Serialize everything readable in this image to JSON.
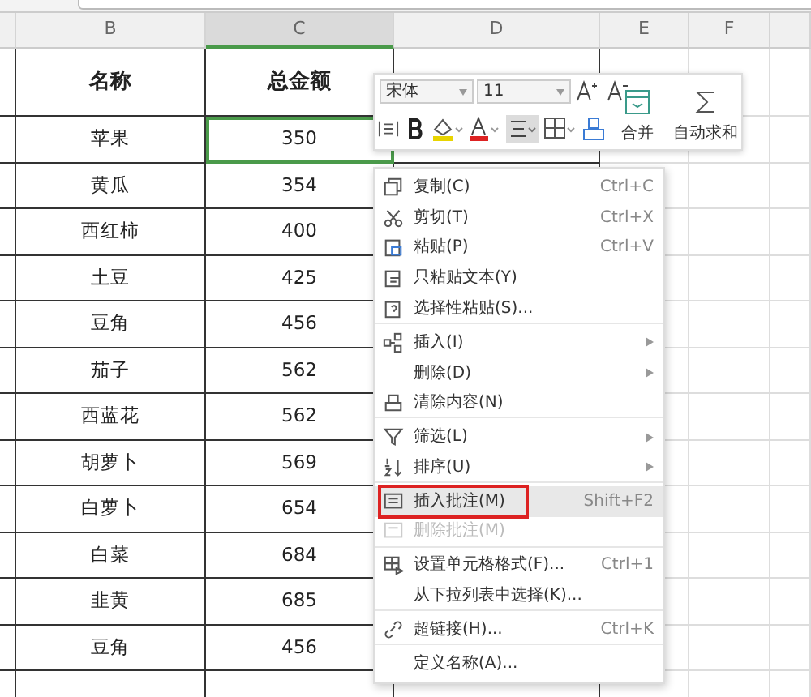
{
  "columns": [
    {
      "label": "B",
      "selected": false
    },
    {
      "label": "C",
      "selected": true
    },
    {
      "label": "D",
      "selected": false
    },
    {
      "label": "E",
      "selected": false
    },
    {
      "label": "F",
      "selected": false
    }
  ],
  "header": {
    "name": "名称",
    "amount": "总金额"
  },
  "rows": [
    {
      "name": "苹果",
      "amount": "350",
      "selected": true
    },
    {
      "name": "黄瓜",
      "amount": "354",
      "selected": false
    },
    {
      "name": "西红柿",
      "amount": "400",
      "selected": false
    },
    {
      "name": "土豆",
      "amount": "425",
      "selected": false
    },
    {
      "name": "豆角",
      "amount": "456",
      "selected": false
    },
    {
      "name": "茄子",
      "amount": "562",
      "selected": false
    },
    {
      "name": "西蓝花",
      "amount": "562",
      "selected": false
    },
    {
      "name": "胡萝卜",
      "amount": "569",
      "selected": false
    },
    {
      "name": "白萝卜",
      "amount": "654",
      "selected": false
    },
    {
      "name": "白菜",
      "amount": "684",
      "selected": false
    },
    {
      "name": "韭黄",
      "amount": "685",
      "selected": false
    },
    {
      "name": "豆角",
      "amount": "456",
      "selected": false
    }
  ],
  "mini_toolbar": {
    "font": "宋体",
    "size": "11",
    "merge": "合并",
    "autosum": "自动求和"
  },
  "context_menu": [
    {
      "label": "复制(C)",
      "shortcut": "Ctrl+C",
      "selected": false,
      "disabled": false,
      "submenu": false,
      "group_end": false
    },
    {
      "label": "剪切(T)",
      "shortcut": "Ctrl+X",
      "selected": false,
      "disabled": false,
      "submenu": false,
      "group_end": false
    },
    {
      "label": "粘贴(P)",
      "shortcut": "Ctrl+V",
      "selected": false,
      "disabled": false,
      "submenu": false,
      "group_end": false
    },
    {
      "label": "只粘贴文本(Y)",
      "selected": false,
      "disabled": false,
      "submenu": false,
      "group_end": false
    },
    {
      "label": "选择性粘贴(S)...",
      "selected": false,
      "disabled": false,
      "submenu": false,
      "group_end": true
    },
    {
      "label": "插入(I)",
      "selected": false,
      "disabled": false,
      "submenu": true,
      "group_end": false
    },
    {
      "label": "删除(D)",
      "selected": false,
      "disabled": false,
      "submenu": true,
      "group_end": false
    },
    {
      "label": "清除内容(N)",
      "selected": false,
      "disabled": false,
      "submenu": false,
      "group_end": true
    },
    {
      "label": "筛选(L)",
      "selected": false,
      "disabled": false,
      "submenu": true,
      "group_end": false
    },
    {
      "label": "排序(U)",
      "selected": false,
      "disabled": false,
      "submenu": true,
      "group_end": true
    },
    {
      "label": "插入批注(M)",
      "shortcut": "Shift+F2",
      "selected": true,
      "disabled": false,
      "submenu": false,
      "group_end": false
    },
    {
      "label": "删除批注(M)",
      "selected": false,
      "disabled": true,
      "submenu": false,
      "group_end": true
    },
    {
      "label": "设置单元格格式(F)...",
      "shortcut": "Ctrl+1",
      "selected": false,
      "disabled": false,
      "submenu": false,
      "group_end": false
    },
    {
      "label": "从下拉列表中选择(K)...",
      "selected": false,
      "disabled": false,
      "submenu": false,
      "group_end": true
    },
    {
      "label": "超链接(H)...",
      "shortcut": "Ctrl+K",
      "selected": false,
      "disabled": false,
      "submenu": false,
      "group_end": true
    },
    {
      "label": "定义名称(A)...",
      "selected": false,
      "disabled": false,
      "submenu": false,
      "group_end": false
    }
  ]
}
